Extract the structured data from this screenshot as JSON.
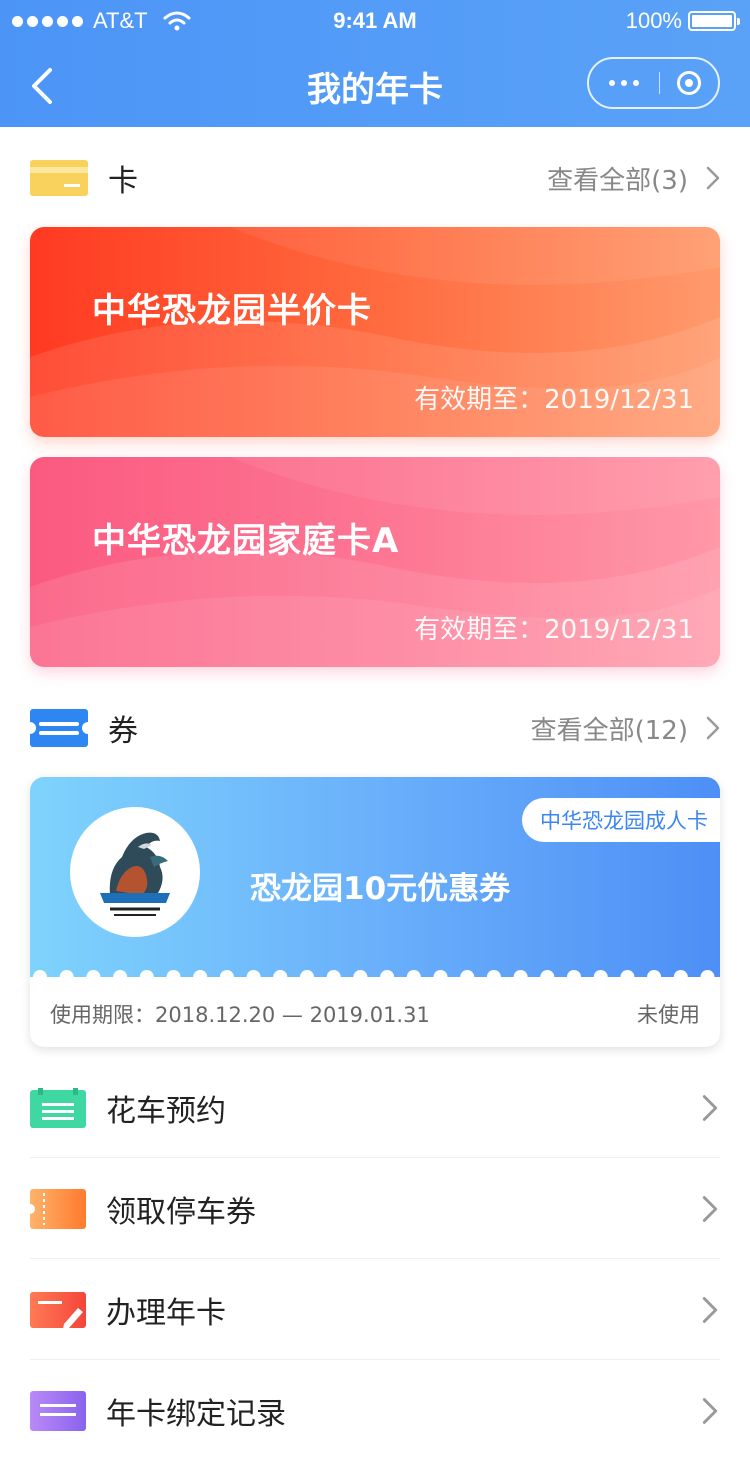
{
  "status_bar": {
    "carrier": "AT&T",
    "time": "9:41 AM",
    "battery": "100%"
  },
  "nav": {
    "title": "我的年卡"
  },
  "cards_section": {
    "label": "卡",
    "view_all": "查看全部(3)",
    "cards": [
      {
        "title": "中华恐龙园半价卡",
        "expiry": "有效期至：2019/12/31"
      },
      {
        "title": "中华恐龙园家庭卡A",
        "expiry": "有效期至：2019/12/31"
      }
    ]
  },
  "coupons_section": {
    "label": "券",
    "view_all": "查看全部(12)",
    "coupon": {
      "title": "恐龙园10元优惠券",
      "tag": "中华恐龙园成人卡",
      "validity": "使用期限：2018.12.20 — 2019.01.31",
      "status": "未使用"
    }
  },
  "menu": [
    {
      "label": "花车预约",
      "icon": "float-calendar-icon",
      "color": "#3fd8a3"
    },
    {
      "label": "领取停车券",
      "icon": "parking-ticket-icon",
      "color": "#ff8a3d"
    },
    {
      "label": "办理年卡",
      "icon": "card-edit-icon",
      "color": "#f5553d"
    },
    {
      "label": "年卡绑定记录",
      "icon": "record-list-icon",
      "color": "#8f6cf0"
    }
  ],
  "colors": {
    "header": "#4c95f7",
    "accent_blue": "#3b86f3"
  }
}
